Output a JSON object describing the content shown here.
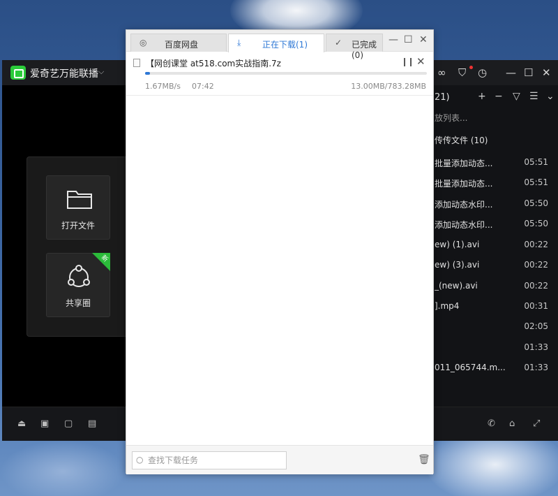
{
  "player": {
    "title": "爱奇艺万能联播",
    "home": {
      "tiles": [
        {
          "label": "打开文件",
          "icon": "folder-icon"
        },
        {
          "label": "共享圈",
          "icon": "share-icon",
          "badge": "新"
        }
      ]
    },
    "playlist": {
      "count_fragment": "21)",
      "search_placeholder": "放列表...",
      "group_label": "传传文件 (10)",
      "items": [
        {
          "name": "批量添加动态...",
          "time": "05:51"
        },
        {
          "name": "批量添加动态...",
          "time": "05:51"
        },
        {
          "name": "添加动态水印...",
          "time": "05:50"
        },
        {
          "name": "添加动态水印...",
          "time": "05:50"
        },
        {
          "name": "ew) (1).avi",
          "time": "00:22"
        },
        {
          "name": "ew) (3).avi",
          "time": "00:22"
        },
        {
          "name": "_(new).avi",
          "time": "00:22"
        },
        {
          "name": "].mp4",
          "time": "00:31"
        },
        {
          "name": "",
          "time": "02:05"
        },
        {
          "name": "",
          "time": "01:33"
        },
        {
          "name": "011_065744.m...",
          "time": "01:33"
        }
      ]
    }
  },
  "downloader": {
    "tabs": [
      {
        "label": "百度网盘",
        "icon": "globe-icon"
      },
      {
        "label": "正在下载(1)",
        "icon": "download-icon"
      },
      {
        "label": "已完成(0)",
        "icon": "check-circle-icon"
      }
    ],
    "active_tab": 1,
    "task": {
      "name": "【网创课堂 at518.com实战指南.7z",
      "speed": "1.67MB/s",
      "eta": "07:42",
      "size": "13.00MB/783.28MB",
      "progress": 0.0166
    },
    "search_placeholder": "查找下载任务"
  },
  "colors": {
    "accent": "#2e78d6",
    "brand_green": "#2bcb3a"
  }
}
